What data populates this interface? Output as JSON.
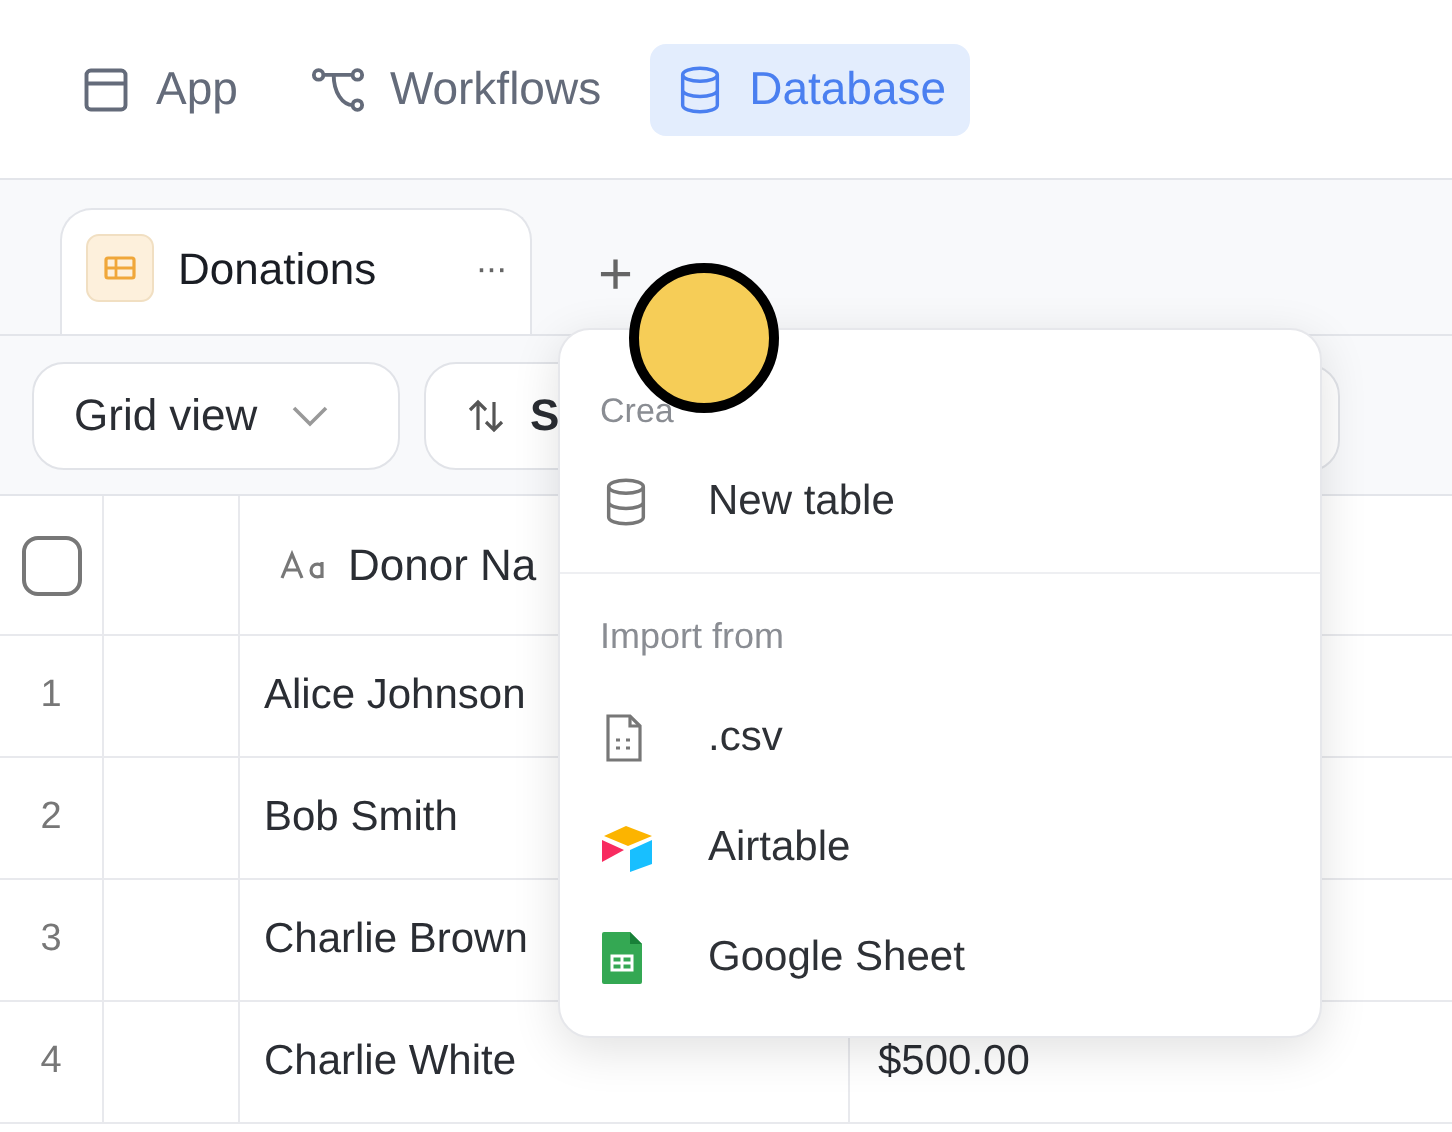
{
  "nav_tabs": [
    {
      "label": "App",
      "selected": false
    },
    {
      "label": "Workflows",
      "selected": false
    },
    {
      "label": "Database",
      "selected": true
    }
  ],
  "table_tabs": [
    {
      "label": "Donations",
      "selected": true,
      "menu": "···"
    }
  ],
  "add_tab": "+",
  "toolbar": {
    "view_button": "Grid view",
    "sort_button": "S"
  },
  "table": {
    "select_all_checked": false,
    "columns": [
      {
        "label": "Donor Na"
      }
    ],
    "rows": [
      {
        "number": "1",
        "name": "Alice Johnson"
      },
      {
        "number": "2",
        "name": "Bob Smith"
      },
      {
        "number": "3",
        "name": "Charlie Brown"
      },
      {
        "number": "4",
        "name": "Charlie White",
        "column_3": "$500.00"
      }
    ]
  },
  "menu": {
    "sections": [
      {
        "label": "Crea",
        "items": [
          {
            "label": "New table"
          }
        ]
      },
      {
        "label": "Import from",
        "items": [
          {
            "label": ".csv"
          },
          {
            "label": "Airtable"
          },
          {
            "label": "Google Sheet"
          }
        ]
      }
    ]
  }
}
